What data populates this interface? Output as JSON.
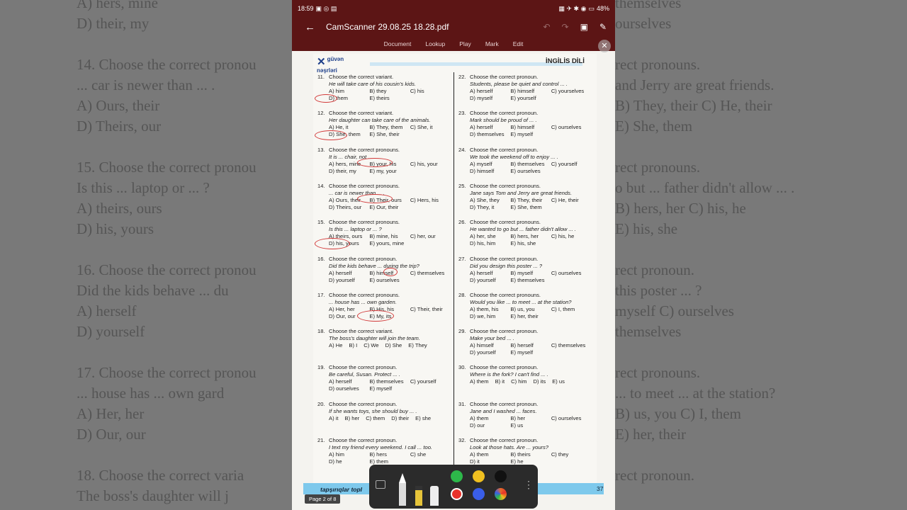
{
  "status_bar": {
    "time": "18:59",
    "battery": "48%"
  },
  "app": {
    "back_icon": "arrow-left-icon",
    "title": "CamScanner 29.08.25 18.28.pdf"
  },
  "tabs": [
    "Document",
    "Lookup",
    "Play",
    "Mark",
    "Edit"
  ],
  "document": {
    "publisher": [
      "güvən",
      "nəşrləri"
    ],
    "subject": "İNGİLİS DİLİ",
    "left_questions": [
      {
        "num": "11.",
        "stem": "Choose the correct variant.",
        "sentence": "He will take care of his cousin's kids.",
        "opts": [
          "A) him",
          "B) they",
          "C) his",
          "D) them",
          "E) theirs"
        ]
      },
      {
        "num": "12.",
        "stem": "Choose the correct variant.",
        "sentence": "Her daughter can take care of the animals.",
        "opts": [
          "A) He, it",
          "B) They, them",
          "C) She, it",
          "D) She, them",
          "E) She, their"
        ]
      },
      {
        "num": "13.",
        "stem": "Choose the correct pronouns.",
        "sentence": "It is ... chair, not ... .",
        "opts": [
          "A) hers, mine",
          "B) your, his",
          "C) his, your",
          "D) their, my",
          "E) my, your"
        ]
      },
      {
        "num": "14.",
        "stem": "Choose the correct pronouns.",
        "sentence": "... car is newer than ... .",
        "opts": [
          "A) Ours, their",
          "B) Their, ours",
          "C) Hers, his",
          "D) Theirs, our",
          "E) Our, their"
        ]
      },
      {
        "num": "15.",
        "stem": "Choose the correct pronouns.",
        "sentence": "Is this ... laptop or ... ?",
        "opts": [
          "A) theirs, ours",
          "B) mine, his",
          "C) her, our",
          "D) his, yours",
          "E) yours, mine"
        ]
      },
      {
        "num": "16.",
        "stem": "Choose the correct pronoun.",
        "sentence": "Did the kids behave ... during the trip?",
        "opts": [
          "A) herself",
          "B) himself",
          "C) themselves",
          "D) yourself",
          "E) ourselves"
        ]
      },
      {
        "num": "17.",
        "stem": "Choose the correct pronouns.",
        "sentence": "... house has ... own garden.",
        "opts": [
          "A) Her, her",
          "B) His, his",
          "C) Their, their",
          "D) Our, our",
          "E) My, its"
        ]
      },
      {
        "num": "18.",
        "stem": "Choose the correct variant.",
        "sentence": "The boss's daughter will join the team.",
        "opts": [
          "A) He",
          "B) I",
          "C) We",
          "D) She",
          "E) They"
        ],
        "five": true
      },
      {
        "num": "19.",
        "stem": "Choose the correct pronoun.",
        "sentence": "Be careful, Susan. Protect ... .",
        "opts": [
          "A) herself",
          "B) themselves",
          "C) yourself",
          "D) ourselves",
          "E) myself"
        ]
      },
      {
        "num": "20.",
        "stem": "Choose the correct pronoun.",
        "sentence": "If she wants toys, she should buy ... .",
        "opts": [
          "A) it",
          "B) her",
          "C) them",
          "D) their",
          "E) she"
        ],
        "five": true
      },
      {
        "num": "21.",
        "stem": "Choose the correct pronoun.",
        "sentence": "I text my friend every weekend. I call ... too.",
        "opts": [
          "A) him",
          "B) hers",
          "C) she",
          "D) he",
          "E) them"
        ]
      }
    ],
    "right_questions": [
      {
        "num": "22.",
        "stem": "Choose the correct pronoun.",
        "sentence": "Students, please be quiet and control ... .",
        "opts": [
          "A) herself",
          "B) himself",
          "C) yourselves",
          "D) myself",
          "E) yourself"
        ]
      },
      {
        "num": "23.",
        "stem": "Choose the correct pronoun.",
        "sentence": "Mark should be proud of ... .",
        "opts": [
          "A) herself",
          "B) himself",
          "C) ourselves",
          "D) themselves",
          "E) myself"
        ]
      },
      {
        "num": "24.",
        "stem": "Choose the correct pronoun.",
        "sentence": "We took the weekend off to enjoy ... .",
        "opts": [
          "A) myself",
          "B) themselves",
          "C) yourself",
          "D) himself",
          "E) ourselves"
        ]
      },
      {
        "num": "25.",
        "stem": "Choose the correct pronouns.",
        "sentence": "Jane says Tom and Jerry are great friends.",
        "opts": [
          "A) She, they",
          "B) They, their",
          "C) He, their",
          "D) They, it",
          "E) She, them"
        ]
      },
      {
        "num": "26.",
        "stem": "Choose the correct pronouns.",
        "sentence": "He wanted to go but ... father didn't allow ... .",
        "opts": [
          "A) her, she",
          "B) hers, her",
          "C) his, he",
          "D) his, him",
          "E) his, she"
        ]
      },
      {
        "num": "27.",
        "stem": "Choose the correct pronoun.",
        "sentence": "Did you design this poster ... ?",
        "opts": [
          "A) herself",
          "B) myself",
          "C) ourselves",
          "D) yourself",
          "E) themselves"
        ]
      },
      {
        "num": "28.",
        "stem": "Choose the correct pronouns.",
        "sentence": "Would you like ... to meet ... at the station?",
        "opts": [
          "A) them, his",
          "B) us, you",
          "C) I, them",
          "D) we, him",
          "E) her, their"
        ]
      },
      {
        "num": "29.",
        "stem": "Choose the correct pronoun.",
        "sentence": "Make your bed ... .",
        "opts": [
          "A) himself",
          "B) herself",
          "C) themselves",
          "D) yourself",
          "E) myself"
        ]
      },
      {
        "num": "30.",
        "stem": "Choose the correct pronoun.",
        "sentence": "Where is the fork? I can't find ... .",
        "opts": [
          "A) them",
          "B) it",
          "C) him",
          "D) its",
          "E) us"
        ],
        "five": true
      },
      {
        "num": "31.",
        "stem": "Choose the correct pronoun.",
        "sentence": "Jane and I washed ... faces.",
        "opts": [
          "A) them",
          "B) her",
          "C) ourselves",
          "D) our",
          "E) us"
        ]
      },
      {
        "num": "32.",
        "stem": "Choose the correct pronoun.",
        "sentence": "Look at those hats. Are ... yours?",
        "opts": [
          "A) them",
          "B) theirs",
          "C) they",
          "D) it",
          "E) he"
        ]
      }
    ],
    "footer_text": "tapşırıqlar topl",
    "page_number": "37",
    "page_label": "Page 2 of 8"
  },
  "annotation_colors": [
    "#2db84a",
    "#f0c020",
    "#111111",
    "#e8322a",
    "#3a5ee8",
    "#e86a2a"
  ],
  "background_zoom": {
    "left": [
      "A) hers, mine",
      "D) their, my",
      "",
      "14. Choose the correct pronou",
      "... car is newer than ... .",
      "A) Ours, their",
      "D) Theirs, our",
      "",
      "15. Choose the correct pronou",
      "Is this ... laptop or ... ?",
      "A) theirs, ours",
      "D) his, yours",
      "",
      "16. Choose the correct pronou",
      "Did the kids behave ... du",
      "A) herself",
      "D) yourself",
      "",
      "17. Choose the correct pronou",
      "... house has ... own gard",
      "A) Her, her",
      "D) Our, our",
      "",
      "18. Choose the correct varia",
      "The boss's daughter will j",
      "A) He"
    ],
    "right": [
      "themselves",
      "ourselves",
      "",
      "rect pronouns.",
      "and Jerry are great friends.",
      "B) They, their   C) He, their",
      "E) She, them",
      "",
      "rect pronouns.",
      "o but ... father didn't allow ... .",
      "B) hers, her   C) his, he",
      "E) his, she",
      "",
      "rect pronoun.",
      "this poster ... ?",
      "myself   C) ourselves",
      "themselves",
      "",
      "rect pronouns.",
      "... to meet ... at the station?",
      "B) us, you   C) I, them",
      "E) her, their",
      "",
      "rect pronoun.",
      "",
      "herself   C) themselves"
    ]
  }
}
